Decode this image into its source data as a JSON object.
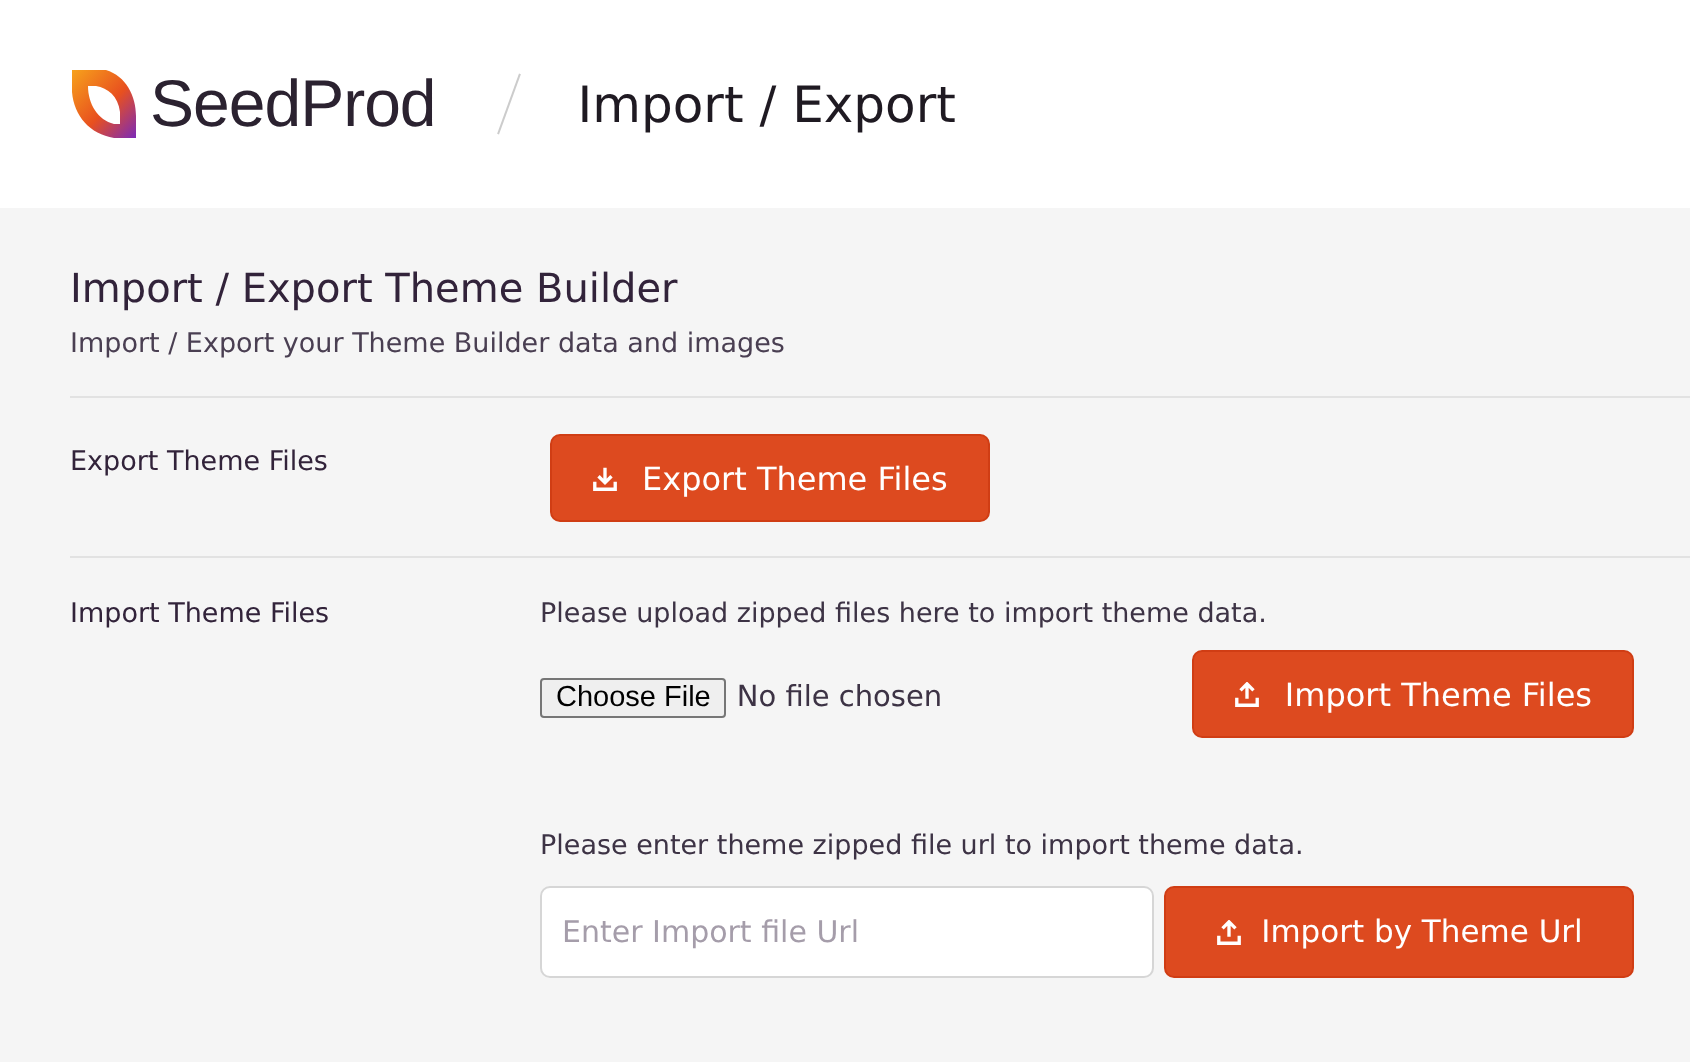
{
  "header": {
    "brand": "SeedProd",
    "title": "Import / Export"
  },
  "section": {
    "heading": "Import / Export Theme Builder",
    "subtitle": "Import / Export your Theme Builder data and images"
  },
  "rows": [
    {
      "label": "Export Theme Files",
      "kind": "export",
      "button": "Export Theme Files"
    },
    {
      "label": "Import Theme Files",
      "kind": "import",
      "upload_hint": "Please upload zipped files here to import theme data.",
      "file_button": "Choose File",
      "file_status": "No file chosen",
      "button": "Import Theme Files",
      "url_hint": "Please enter theme zipped file url to import theme data.",
      "url_placeholder": "Enter Import file Url",
      "url_button": "Import by Theme Url"
    }
  ]
}
